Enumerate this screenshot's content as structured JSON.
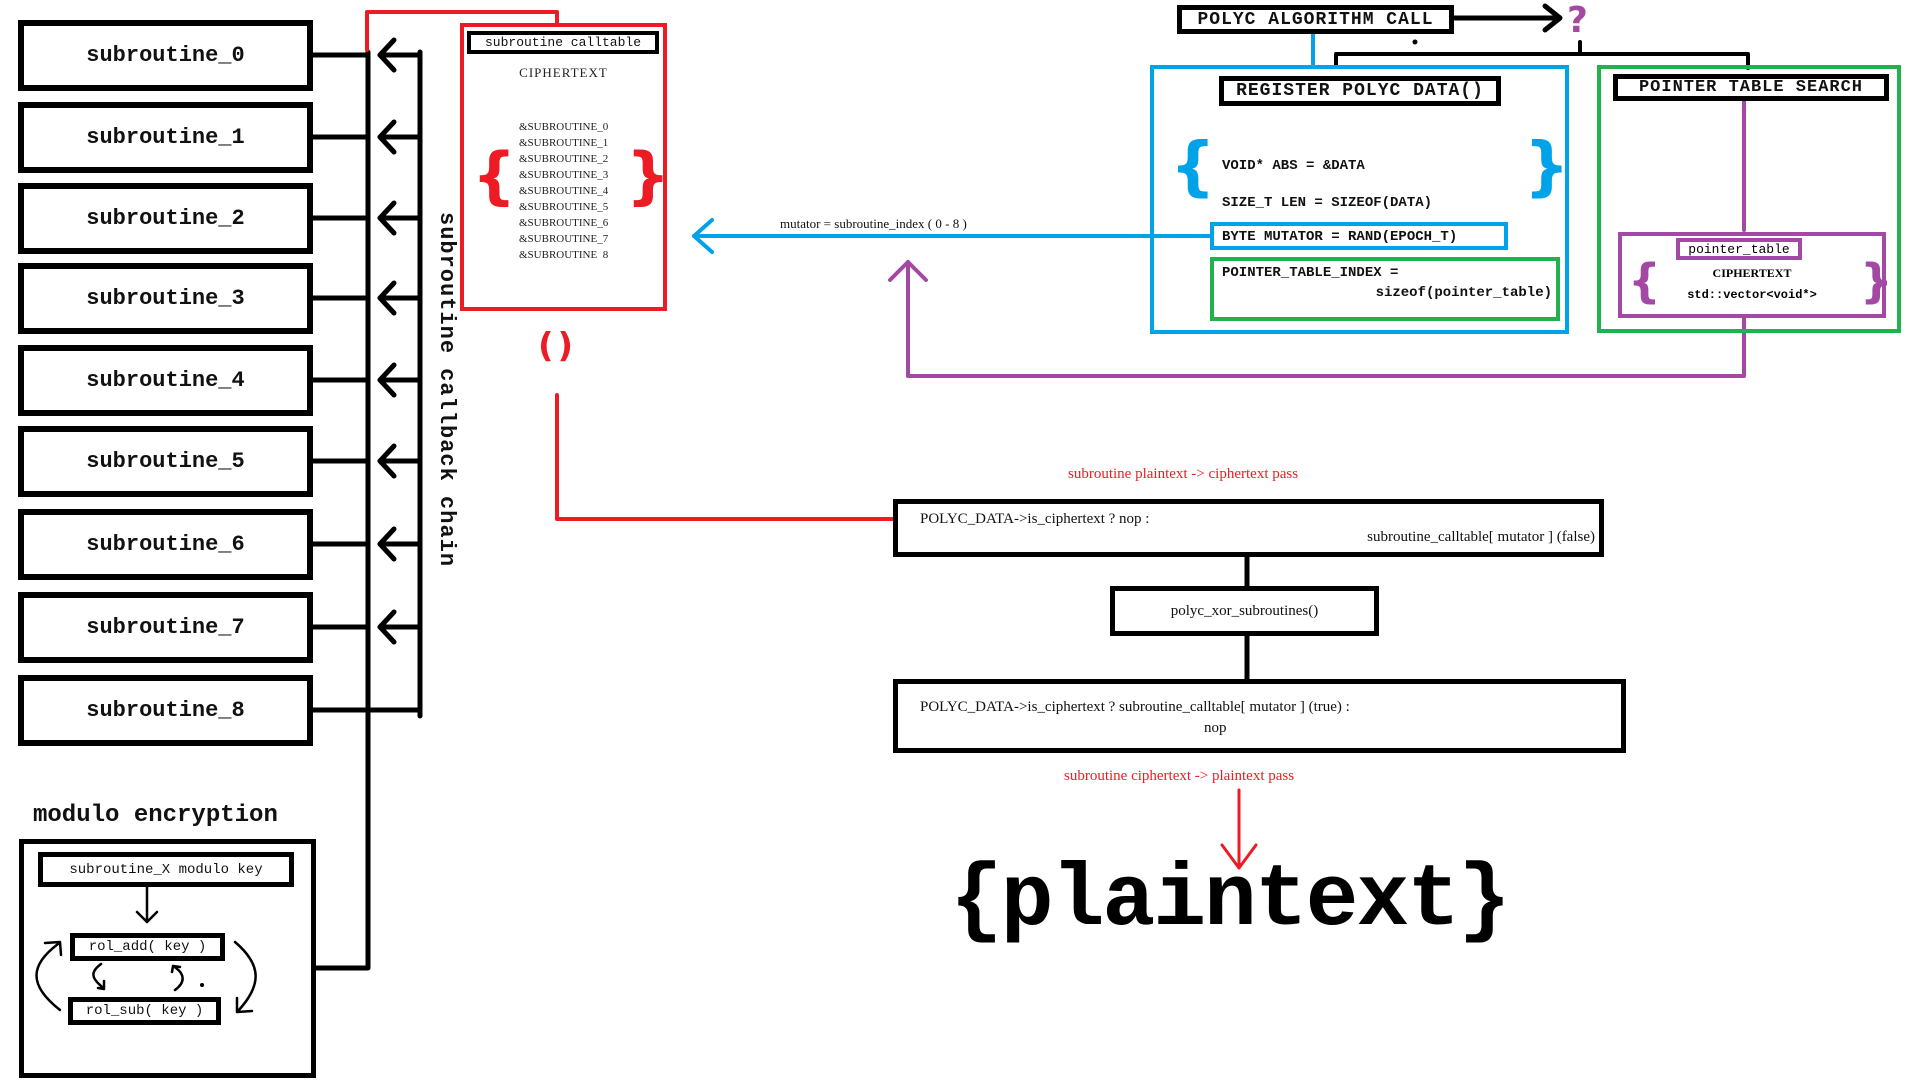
{
  "colors": {
    "red": "#ed1c24",
    "blue": "#00a2e8",
    "green": "#22b14c",
    "purple": "#a349a4",
    "black": "#000000"
  },
  "subroutines": [
    {
      "label": "subroutine_0"
    },
    {
      "label": "subroutine_1"
    },
    {
      "label": "subroutine_2"
    },
    {
      "label": "subroutine_3"
    },
    {
      "label": "subroutine_4"
    },
    {
      "label": "subroutine_5"
    },
    {
      "label": "subroutine_6"
    },
    {
      "label": "subroutine_7"
    },
    {
      "label": "subroutine_8"
    }
  ],
  "callback_chain_label": "subroutine callback chain",
  "calltable": {
    "title": "subroutine calltable",
    "state": "CIPHERTEXT",
    "entries": [
      "&SUBROUTINE_0",
      "&SUBROUTINE_1",
      "&SUBROUTINE_2",
      "&SUBROUTINE_3",
      "&SUBROUTINE_4",
      "&SUBROUTINE_5",
      "&SUBROUTINE_6",
      "&SUBROUTINE_7",
      "&SUBROUTINE_8"
    ],
    "open_brace": "{",
    "close_brace": "}",
    "call_parens": "()"
  },
  "modulo": {
    "title": "modulo encryption",
    "key_box": "subroutine_X modulo key",
    "rol_add": "rol_add( key )",
    "rol_sub": "rol_sub( key )"
  },
  "mutator_label": "mutator = subroutine_index ( 0 - 8 )",
  "polyc": {
    "call_title": "POLYC ALGORITHM CALL",
    "unknown": "?",
    "register": {
      "title": "REGISTER POLYC DATA()",
      "lines": [
        "VOID* ABS = &DATA",
        "SIZE_T LEN = SIZEOF(DATA)"
      ],
      "mutator": "BYTE MUTATOR = RAND(EPOCH_T)",
      "pointer_index_line1": "POINTER_TABLE_INDEX =",
      "pointer_index_line2": "sizeof(pointer_table)",
      "open_brace": "{",
      "close_brace": "}"
    },
    "pointer_search": {
      "title": "POINTER TABLE SEARCH",
      "table_title": "pointer_table",
      "state": "CIPHERTEXT",
      "type": "std::vector<void*>",
      "open_brace": "{",
      "close_brace": "}"
    }
  },
  "flow": {
    "encrypt_label": "subroutine plaintext -> ciphertext pass",
    "step1_line1": "POLYC_DATA->is_ciphertext ? nop :",
    "step1_line2": "subroutine_calltable[ mutator ] (false)",
    "step2": "polyc_xor_subroutines()",
    "step3_line1": "POLYC_DATA->is_ciphertext ? subroutine_calltable[ mutator ] (true) :",
    "step3_line2": "nop",
    "decrypt_label": "subroutine ciphertext -> plaintext pass",
    "result": "{plaintext}"
  }
}
